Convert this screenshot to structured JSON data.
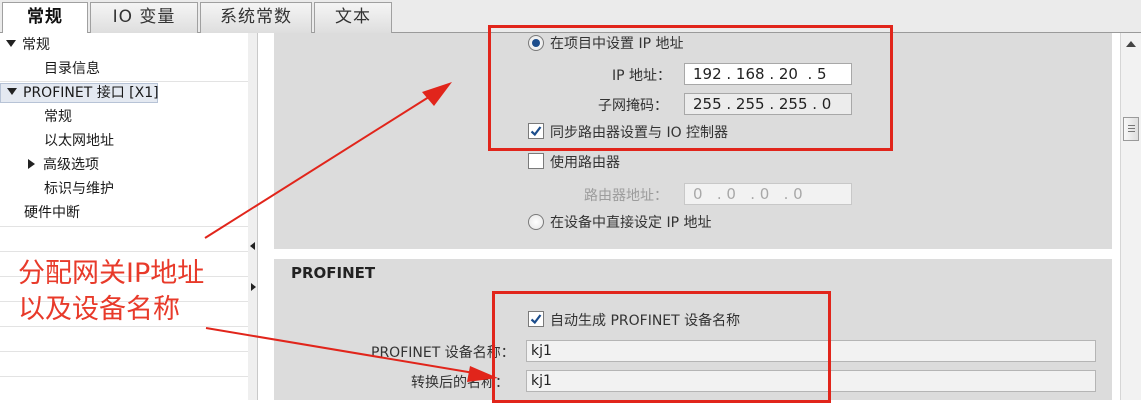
{
  "tabs": [
    "常规",
    "IO 变量",
    "系统常数",
    "文本"
  ],
  "tree": {
    "general": "常规",
    "catalog_info": "目录信息",
    "profinet_interface": "PROFINET 接口 [X1]",
    "pn_general": "常规",
    "ethernet_address": "以太网地址",
    "advanced_options": "高级选项",
    "identification": "标识与维护",
    "hardware_interrupt": "硬件中断"
  },
  "ip_section": {
    "set_in_project_label": "在项目中设置 IP 地址",
    "ip_label": "IP 地址：",
    "ip_value": "192 . 168 . 20  . 5",
    "subnet_label": "子网掩码：",
    "subnet_value": "255 . 255 . 255 . 0",
    "sync_router_label": "同步路由器设置与 IO 控制器",
    "sync_router_checked": true,
    "use_router_label": "使用路由器",
    "use_router_checked": false,
    "router_address_label": "路由器地址：",
    "router_address_value": "0   . 0   . 0   . 0",
    "set_on_device_label": "在设备中直接设定 IP 地址"
  },
  "profinet_section": {
    "title": "PROFINET",
    "auto_generate_label": "自动生成 PROFINET 设备名称",
    "auto_generate_checked": true,
    "device_name_label": "PROFINET 设备名称：",
    "device_name_value": "kj1",
    "converted_name_label": "转换后的名称：",
    "converted_name_value": "kj1"
  },
  "annotation": {
    "line1": "分配网关IP地址",
    "line2": "以及设备名称",
    "color": "#e83a2a"
  },
  "colors": {
    "highlight_box": "#e1251b",
    "section_bg": "#dcdcdc",
    "radio_dot": "#1c4d8c",
    "check_mark": "#1c4d8c"
  }
}
